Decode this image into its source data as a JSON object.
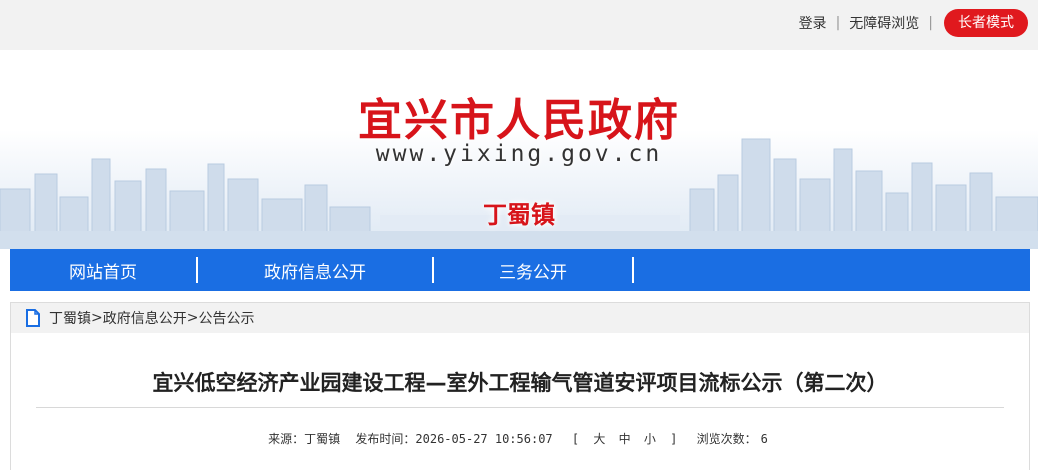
{
  "topbar": {
    "login_label": "登录",
    "accessible_label": "无障碍浏览",
    "elder_mode_label": "长者模式"
  },
  "banner": {
    "site_title": "宜兴市人民政府",
    "site_url": "www.yixing.gov.cn",
    "town_name": "丁蜀镇"
  },
  "nav": {
    "items": [
      "网站首页",
      "政府信息公开",
      "三务公开"
    ]
  },
  "breadcrumb": {
    "items": [
      "丁蜀镇",
      "政府信息公开",
      "公告公示"
    ],
    "separator": ">"
  },
  "article": {
    "title": "宜兴低空经济产业园建设工程—室外工程输气管道安评项目流标公示（第二次）",
    "source_label": "来源：丁蜀镇",
    "published_label": "发布时间：2026-05-27 10:56:07",
    "size_open": "[",
    "size_large": "大",
    "size_medium": "中",
    "size_small": "小",
    "size_close": "]",
    "views_label": "浏览次数：",
    "views_count": "6"
  },
  "colors": {
    "brand_red": "#d7141a",
    "nav_blue": "#1a6ee3",
    "topbar_bg": "#f2f2f2"
  }
}
